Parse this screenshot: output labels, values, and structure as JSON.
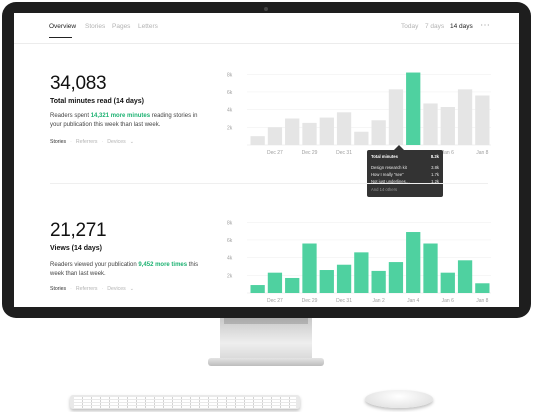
{
  "nav": {
    "tabs": [
      {
        "label": "Overview"
      },
      {
        "label": "Stories"
      },
      {
        "label": "Pages"
      },
      {
        "label": "Letters"
      }
    ],
    "ranges": [
      {
        "label": "Today"
      },
      {
        "label": "7 days"
      },
      {
        "label": "14 days"
      }
    ],
    "more_icon": "more-horizontal-icon"
  },
  "minutes": {
    "value": "34,083",
    "label": "Total minutes read (14 days)",
    "desc_pre": "Readers spent ",
    "desc_highlight": "14,321 more minutes",
    "desc_post": " reading stories in your publication this week than last week.",
    "filters": {
      "stories": "Stories",
      "referrers": "Referrers",
      "devices": "Devices"
    }
  },
  "views": {
    "value": "21,271",
    "label": "Views (14 days)",
    "desc_pre": "Readers viewed your publication ",
    "desc_highlight": "9,452 more times",
    "desc_post": " this week than last week.",
    "filters": {
      "stories": "Stories",
      "referrers": "Referrers",
      "devices": "Devices"
    }
  },
  "tooltip": {
    "title": "Total minutes",
    "title_value": "8.2k",
    "rows": [
      {
        "label": "Design research kit",
        "value": "3.8k"
      },
      {
        "label": "How I really “see”",
        "value": "1.7k"
      },
      {
        "label": "Not just underlines…",
        "value": "1.2k"
      }
    ],
    "others": "And 14 others"
  },
  "colors": {
    "accent": "#1db272",
    "bar_green": "#4fd1a0",
    "bar_gray": "#e5e5e5"
  },
  "chart_data": [
    {
      "type": "bar",
      "yticks": [
        "2k",
        "4k",
        "6k",
        "8k"
      ],
      "ylim": [
        0,
        8600
      ],
      "xticks": [
        "Dec 27",
        "Dec 29",
        "Dec 31",
        "Jan 2",
        "Jan 4",
        "Jan 6",
        "Jan 8"
      ],
      "values": [
        1000,
        2000,
        3000,
        2500,
        3100,
        3700,
        1500,
        2800,
        6300,
        8200,
        4700,
        4300,
        6300,
        5600
      ],
      "highlight_index": 9
    },
    {
      "type": "bar",
      "yticks": [
        "2k",
        "4k",
        "6k",
        "8k"
      ],
      "ylim": [
        0,
        8600
      ],
      "xticks": [
        "Dec 27",
        "Dec 29",
        "Dec 31",
        "Jan 2",
        "Jan 4",
        "Jan 6",
        "Jan 8"
      ],
      "values": [
        900,
        2300,
        1700,
        5600,
        2600,
        3200,
        4600,
        2500,
        3500,
        6900,
        5600,
        2300,
        3700,
        1100
      ]
    }
  ]
}
